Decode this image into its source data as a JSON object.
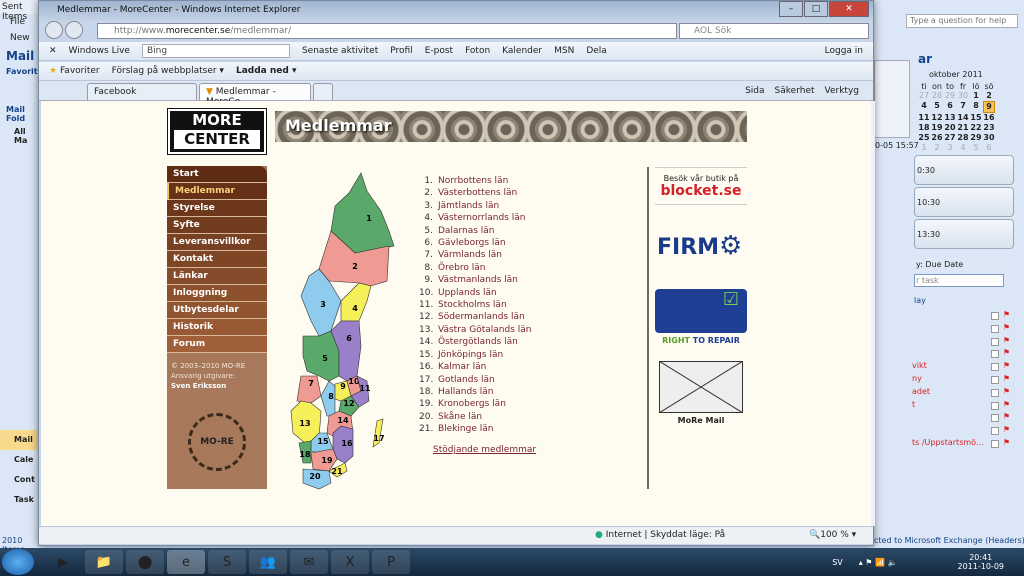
{
  "outlook": {
    "title": "Sent Items",
    "menu_file": "File",
    "new": "New",
    "mail": "Mail",
    "favorites": "Favorite",
    "mail_folders": "Mail Fold",
    "all_mail": "All Ma",
    "nav": [
      "Mail",
      "Cale",
      "Cont",
      "Task"
    ],
    "status_items": "2010 Items",
    "help_placeholder": "Type a question for help",
    "todo": "ar",
    "calendar_month": "oktober 2011",
    "weekdays": [
      "ti",
      "on",
      "to",
      "fr",
      "lö",
      "sö"
    ],
    "weeks": [
      [
        "27",
        "28",
        "29",
        "30",
        "1",
        "2"
      ],
      [
        "4",
        "5",
        "6",
        "7",
        "8",
        "9"
      ],
      [
        "11",
        "12",
        "13",
        "14",
        "15",
        "16"
      ],
      [
        "18",
        "19",
        "20",
        "21",
        "22",
        "23"
      ],
      [
        "25",
        "26",
        "27",
        "28",
        "29",
        "30"
      ],
      [
        "1",
        "2",
        "3",
        "4",
        "5",
        "6"
      ]
    ],
    "today": "9",
    "appointments": [
      "0:30",
      "10:30",
      "13:30"
    ],
    "msg_time": "0-05 15:57",
    "arranged": "y: Due Date",
    "new_task": "r task",
    "today_label": "lay",
    "tasks": [
      "",
      "",
      "",
      "",
      "vikt",
      "ny",
      "adet",
      "t",
      "",
      "",
      "ts /Uppstartsmö..."
    ],
    "exchange": "cted to Microsoft Exchange (Headers)"
  },
  "ie": {
    "title": "Medlemmar - MoreCenter - Windows Internet Explorer",
    "url_prefix": "http://www.",
    "url_domain": "morecenter.se",
    "url_path": "/medlemmar/",
    "search_placeholder": "AOL Sök",
    "live": {
      "brand": "Windows Live",
      "search": "Bing",
      "links": [
        "Senaste aktivitet",
        "Profil",
        "E-post",
        "Foton",
        "Kalender",
        "MSN",
        "Dela"
      ],
      "login": "Logga in"
    },
    "favorites": {
      "label": "Favoriter",
      "suggest": "Förslag på webbplatser",
      "download": "Ladda ned"
    },
    "tabs": [
      "Facebook",
      "Medlemmar - MoreCe..."
    ],
    "commands": [
      "Sida",
      "Säkerhet",
      "Verktyg"
    ],
    "status": {
      "zone": "Internet | Skyddat läge: På",
      "zoom": "100 %"
    }
  },
  "page": {
    "logo": [
      "MORE",
      "CENTER"
    ],
    "banner": "Medlemmar",
    "nav": [
      "Start",
      "Medlemmar",
      "Styrelse",
      "Syfte",
      "Leveransvillkor",
      "Kontakt",
      "Länkar",
      "Inloggning",
      "Utbytesdelar",
      "Historik",
      "Forum"
    ],
    "active_nav": "Medlemmar",
    "copyright": "© 2003–2010 MO-RE",
    "publisher_label": "Ansvarig utgivare:",
    "publisher": "Sven Eriksson",
    "seal": "MO-RE",
    "counties": [
      "Norrbottens län",
      "Västerbottens län",
      "Jämtlands län",
      "Västernorrlands län",
      "Dalarnas län",
      "Gävleborgs län",
      "Värmlands län",
      "Örebro län",
      "Västmanlands län",
      "Upplands län",
      "Stockholms län",
      "Södermanlands län",
      "Västra Götalands län",
      "Östergötlands län",
      "Jönköpings län",
      "Kalmar län",
      "Gotlands län",
      "Hallands län",
      "Kronobergs län",
      "Skåne län",
      "Blekinge län"
    ],
    "supporting": "Stödjande medlemmar",
    "blocket_text": "Besök vår butik på",
    "blocket_logo": "blocket.se",
    "firm": "FIRM",
    "rtr_1": "RIGHT",
    "rtr_2": "TO REPAIR",
    "mail_label": "MoRe Mail"
  },
  "taskbar": {
    "lang": "SV",
    "time": "20:41",
    "date": "2011-10-09"
  },
  "colors": {
    "nav": "#6b3a1e",
    "link": "#7a2436",
    "bg": "#fefcf0"
  }
}
